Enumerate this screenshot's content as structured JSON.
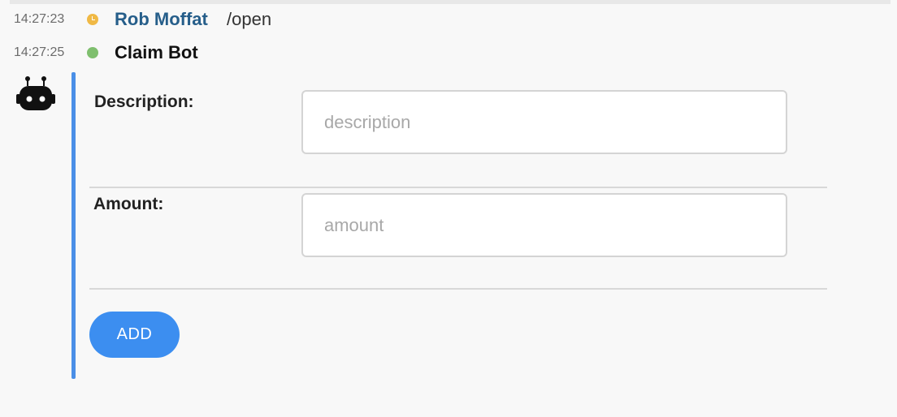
{
  "messages": [
    {
      "time": "14:27:23",
      "status": "away",
      "sender": "Rob Moffat",
      "text": "/open"
    },
    {
      "time": "14:27:25",
      "status": "online",
      "sender": "Claim Bot",
      "text": ""
    }
  ],
  "form": {
    "description_label": "Description:",
    "description_placeholder": "description",
    "description_value": "",
    "amount_label": "Amount:",
    "amount_placeholder": "amount",
    "amount_value": "",
    "add_label": "ADD"
  },
  "icons": {
    "bot_avatar": "robot-icon",
    "away_status": "clock-icon",
    "online_status": "online-dot-icon"
  },
  "colors": {
    "user_name": "#265e8a",
    "attachment_bar": "#4a8fe7",
    "button": "#3c8ef0",
    "away": "#f0b945",
    "online": "#7fbf6e"
  }
}
